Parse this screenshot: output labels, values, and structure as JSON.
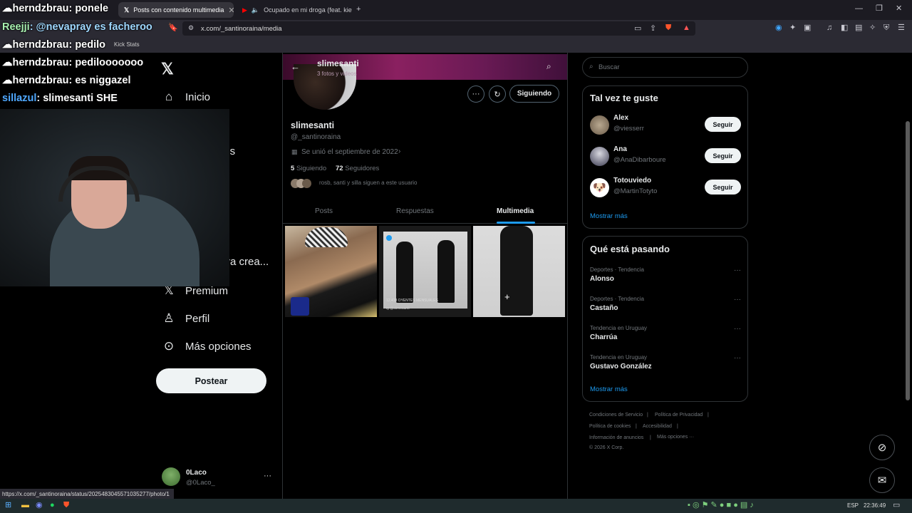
{
  "browser": {
    "tabs": [
      {
        "label": "Posts con contenido multimedia",
        "active": true
      },
      {
        "label": "Ocupado en mi droga (feat. kiet",
        "active": false
      }
    ],
    "url": "x.com/_santinoraina/media",
    "bookmark": "Kick Stats",
    "status_url": "https://x.com/_santinoraina/status/2025483045571035277/photo/1"
  },
  "chat": [
    {
      "user": "herndzbrau",
      "message": "ponele"
    },
    {
      "user": "Reejji",
      "message": "@nevapray es facheroo"
    },
    {
      "user": "herndzbrau",
      "message": "pedilo"
    },
    {
      "user": "herndzbrau",
      "message": "pedilooooooo"
    },
    {
      "user": "herndzbrau",
      "message": "es niggazel"
    },
    {
      "user": "sillazul",
      "message": "slimesanti SHE"
    }
  ],
  "nav": {
    "items": [
      "Inicio",
      "nes",
      "ra crea...",
      "Premium",
      "Perfil",
      "Más opciones"
    ],
    "post_label": "Postear",
    "account_name": "0Laco",
    "account_handle": "@0Laco_"
  },
  "profile": {
    "header_name": "slimesanti",
    "header_sub": "3 fotos y videos",
    "name": "slimesanti",
    "handle": "@_santinoraina",
    "joined": "Se unió el septiembre de 2022",
    "following_count": "5",
    "following_label": "Siguiendo",
    "followers_count": "72",
    "followers_label": "Seguidores",
    "followed_by": "rosb, santi y silla siguen a este usuario",
    "follow_button": "Siguiendo",
    "tabs": [
      "Posts",
      "Respuestas",
      "Multimedia"
    ],
    "active_tab": "Multimedia",
    "thumb2_caption": "12,418  OYENTES MENSUALES",
    "thumb2_tag": "ig @slimesanti"
  },
  "sidebar": {
    "search_placeholder": "Buscar",
    "suggest_title": "Tal vez te guste",
    "suggestions": [
      {
        "name": "Alex",
        "handle": "@viesserr",
        "button": "Seguir"
      },
      {
        "name": "Ana",
        "handle": "@AnaDibarboure",
        "button": "Seguir"
      },
      {
        "name": "Totouviedo",
        "handle": "@MartinTotyto",
        "button": "Seguir"
      }
    ],
    "show_more": "Mostrar más",
    "trends_title": "Qué está pasando",
    "trends": [
      {
        "context": "Deportes · Tendencia",
        "topic": "Alonso"
      },
      {
        "context": "Deportes · Tendencia",
        "topic": "Castaño"
      },
      {
        "context": "Tendencia en Uruguay",
        "topic": "Charrúa"
      },
      {
        "context": "Tendencia en Uruguay",
        "topic": "Gustavo González"
      }
    ],
    "trends_more": "Mostrar más",
    "footer": {
      "terms": "Condiciones de Servicio",
      "privacy": "Política de Privacidad",
      "cookies": "Política de cookies",
      "access": "Accesibilidad",
      "ads": "Información de anuncios",
      "more": "Más opciones ···",
      "copy": "© 2026 X Corp."
    }
  },
  "taskbar": {
    "lang": "ESP",
    "time": "22:36:49"
  }
}
